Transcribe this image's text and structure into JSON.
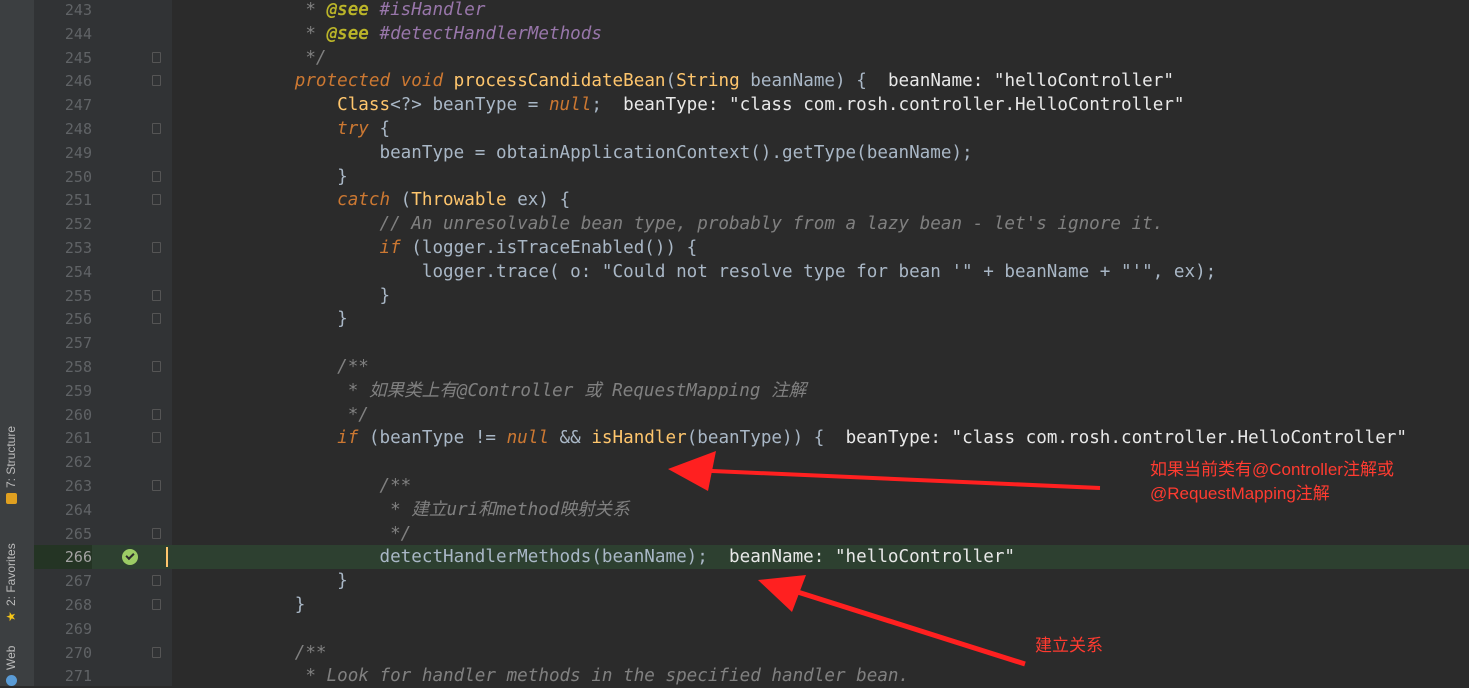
{
  "sidebar": {
    "tabs": [
      {
        "label": "7: Structure",
        "icon": "structure-icon"
      },
      {
        "label": "2: Favorites",
        "icon": "star-icon"
      },
      {
        "label": "Web",
        "icon": "web-icon"
      }
    ]
  },
  "editor": {
    "lines": [
      {
        "num": "243",
        "code": "         * @see #isHandler"
      },
      {
        "num": "244",
        "code": "         * @see #detectHandlerMethods"
      },
      {
        "num": "245",
        "code": "         */"
      },
      {
        "num": "246",
        "code": "        protected void processCandidateBean(String beanName) {  beanName: \"helloController\""
      },
      {
        "num": "247",
        "code": "            Class<?> beanType = null;  beanType: \"class com.rosh.controller.HelloController\""
      },
      {
        "num": "248",
        "code": "            try {"
      },
      {
        "num": "249",
        "code": "                beanType = obtainApplicationContext().getType(beanName);"
      },
      {
        "num": "250",
        "code": "            }"
      },
      {
        "num": "251",
        "code": "            catch (Throwable ex) {"
      },
      {
        "num": "252",
        "code": "                // An unresolvable bean type, probably from a lazy bean - let's ignore it."
      },
      {
        "num": "253",
        "code": "                if (logger.isTraceEnabled()) {"
      },
      {
        "num": "254",
        "code": "                    logger.trace( o: \"Could not resolve type for bean '\" + beanName + \"'\", ex);"
      },
      {
        "num": "255",
        "code": "                }"
      },
      {
        "num": "256",
        "code": "            }"
      },
      {
        "num": "257",
        "code": ""
      },
      {
        "num": "258",
        "code": "            /**"
      },
      {
        "num": "259",
        "code": "             * 如果类上有@Controller 或 RequestMapping 注解"
      },
      {
        "num": "260",
        "code": "             */"
      },
      {
        "num": "261",
        "code": "            if (beanType != null && isHandler(beanType)) {  beanType: \"class com.rosh.controller.HelloController\""
      },
      {
        "num": "262",
        "code": ""
      },
      {
        "num": "263",
        "code": "                /**"
      },
      {
        "num": "264",
        "code": "                 * 建立uri和method映射关系"
      },
      {
        "num": "265",
        "code": "                 */"
      },
      {
        "num": "266",
        "code": "                detectHandlerMethods(beanName);  beanName: \"helloController\""
      },
      {
        "num": "267",
        "code": "            }"
      },
      {
        "num": "268",
        "code": "        }"
      },
      {
        "num": "269",
        "code": ""
      },
      {
        "num": "270",
        "code": "        /**"
      },
      {
        "num": "271",
        "code": "         * Look for handler methods in the specified handler bean."
      }
    ],
    "current_line": "266"
  },
  "annotations": {
    "note1_line1": "如果当前类有@Controller注解或",
    "note1_line2": "@RequestMapping注解",
    "note2": "建立关系",
    "color": "#ff2a2a"
  }
}
